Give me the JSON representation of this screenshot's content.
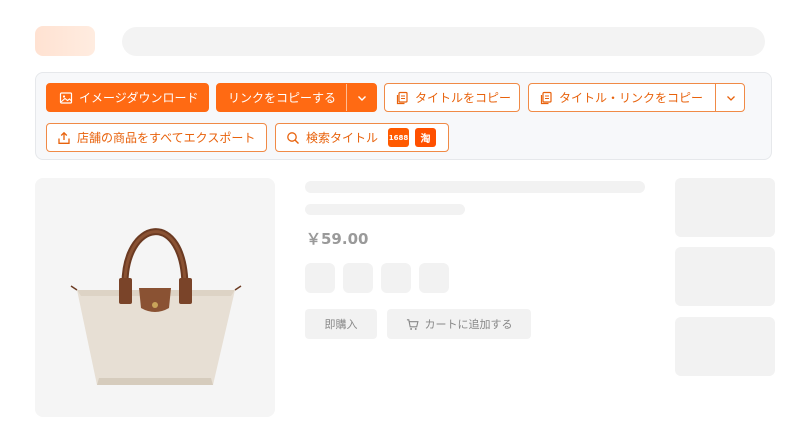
{
  "toolbar": {
    "download_image": "イメージダウンロード",
    "copy_link": "リンクをコピーする",
    "copy_title": "タイトルをコピー",
    "copy_title_link": "タイトル・リンクをコピー",
    "export_shop": "店舗の商品をすべてエクスポート",
    "search_title": "検索タイトル",
    "badge_1688": "1688",
    "badge_taobao": "淘"
  },
  "product": {
    "price": "￥59.00",
    "buy_now": "即購入",
    "add_to_cart": "カートに追加する"
  },
  "colors": {
    "accent": "#ff6a13",
    "accent_border": "#f08a46",
    "toolbar_bg": "#f7f8fa",
    "placeholder": "#f2f2f2"
  }
}
